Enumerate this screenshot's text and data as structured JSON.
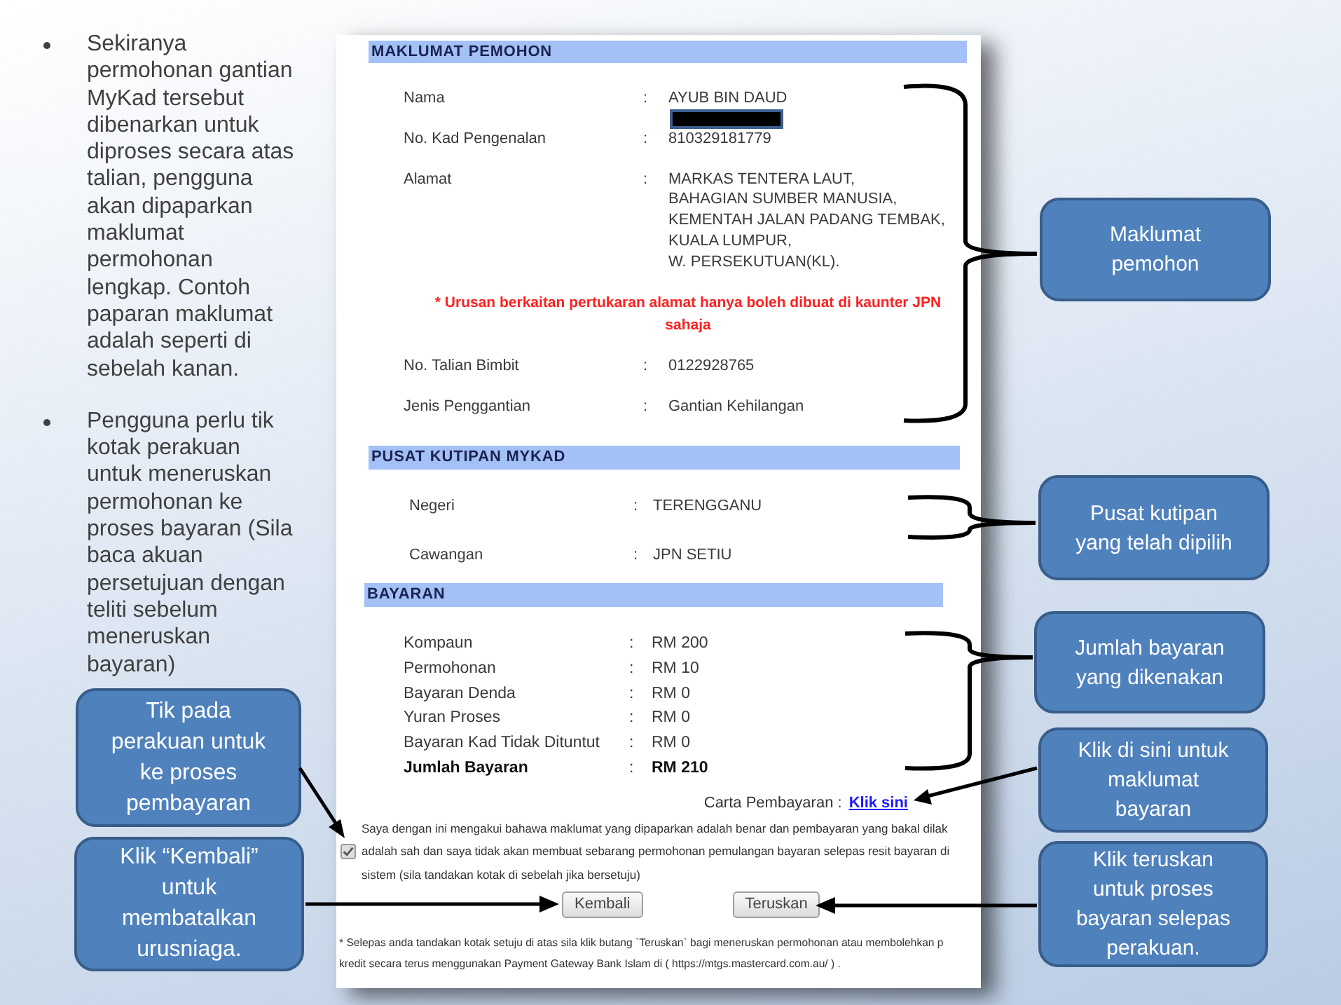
{
  "notes": [
    {
      "lines": [
        "Sekiranya",
        "permohonan gantian",
        "MyKad tersebut",
        "dibenarkan untuk",
        "diproses secara atas",
        "talian, pengguna",
        "akan dipaparkan",
        "maklumat",
        "permohonan",
        "lengkap. Contoh",
        "paparan maklumat",
        "adalah seperti di",
        "sebelah kanan."
      ]
    },
    {
      "lines": [
        "Pengguna perlu tik",
        "kotak perakuan",
        "untuk meneruskan",
        "permohonan ke",
        "proses bayaran (Sila",
        "baca akuan",
        "persetujuan dengan",
        "teliti sebelum",
        "meneruskan",
        "bayaran)"
      ]
    }
  ],
  "form": {
    "sections": [
      {
        "kind": "applicant",
        "title": "MAKLUMAT PEMOHON",
        "items": [
          {
            "kind": "field",
            "label": "Nama",
            "separator": ":",
            "lines": [
              "AYUB BIN DAUD"
            ],
            "redacted": true
          },
          {
            "kind": "field",
            "label": "No. Kad Pengenalan",
            "separator": ":",
            "lines": [
              "810329181779"
            ]
          },
          {
            "kind": "field",
            "label": "Alamat",
            "separator": ":",
            "lines": [
              "MARKAS TENTERA LAUT,",
              "BAHAGIAN SUMBER MANUSIA,",
              "KEMENTAH JALAN PADANG TEMBAK,",
              "KUALA LUMPUR,",
              "W. PERSEKUTUAN(KL)."
            ]
          },
          {
            "kind": "notice",
            "text": "* Urusan berkaitan pertukaran alamat hanya boleh dibuat di kaunter JPN sahaja"
          },
          {
            "kind": "field",
            "label": "No. Talian Bimbit",
            "separator": ":",
            "lines": [
              "0122928765"
            ]
          },
          {
            "kind": "field",
            "label": "Jenis Penggantian",
            "separator": ":",
            "lines": [
              "Gantian Kehilangan"
            ]
          }
        ]
      },
      {
        "kind": "collection",
        "title": "PUSAT KUTIPAN MYKAD",
        "items": [
          {
            "kind": "field",
            "label": "Negeri",
            "separator": ":",
            "lines": [
              "TERENGGANU"
            ]
          },
          {
            "kind": "field",
            "label": "Cawangan",
            "separator": ":",
            "lines": [
              "JPN SETIU"
            ]
          }
        ]
      },
      {
        "kind": "payment",
        "title": "BAYARAN",
        "items": [
          {
            "kind": "field",
            "label": "Kompaun",
            "separator": ":",
            "lines": [
              "RM 200"
            ],
            "total": false
          },
          {
            "kind": "field",
            "label": "Permohonan",
            "separator": ":",
            "lines": [
              "RM 10"
            ],
            "total": false
          },
          {
            "kind": "field",
            "label": "Bayaran Denda",
            "separator": ":",
            "lines": [
              "RM 0"
            ],
            "total": false
          },
          {
            "kind": "field",
            "label": "Yuran Proses",
            "separator": ":",
            "lines": [
              "RM 0"
            ],
            "total": false
          },
          {
            "kind": "field",
            "label": "Bayaran Kad Tidak Dituntut",
            "separator": ":",
            "lines": [
              "RM 0"
            ],
            "total": false
          },
          {
            "kind": "field",
            "label": "Jumlah Bayaran",
            "separator": ":",
            "lines": [
              "RM 210"
            ],
            "total": true
          }
        ]
      }
    ],
    "chart_link": {
      "label": "Carta Pembayaran :",
      "link": "Klik sini"
    },
    "declaration": {
      "checked": true,
      "lines": [
        "Saya dengan ini mengakui bahawa maklumat yang dipaparkan adalah benar dan pembayaran yang bakal dilak",
        "adalah sah dan saya tidak akan membuat sebarang permohonan pemulangan bayaran selepas resit bayaran di",
        "sistem (sila tandakan kotak di sebelah jika bersetuju)"
      ]
    },
    "buttons": [
      {
        "label": "Kembali"
      },
      {
        "label": "Teruskan"
      }
    ],
    "footnote": {
      "lines": [
        "* Selepas anda tandakan kotak setuju di atas sila klik butang `Teruskan` bagi meneruskan permohonan atau membolehkan p",
        "kredit secara terus menggunakan Payment Gateway Bank Islam di ( https://mtgs.mastercard.com.au/ ) ."
      ]
    }
  },
  "left_callouts": [
    {
      "lines": [
        "Tik pada",
        "perakuan untuk",
        "ke proses",
        "pembayaran"
      ]
    },
    {
      "lines": [
        "Klik “Kembali”",
        "untuk",
        "membatalkan",
        "urusniaga."
      ]
    }
  ],
  "right_callouts": [
    {
      "lines": [
        "Maklumat",
        "pemohon"
      ]
    },
    {
      "lines": [
        "Pusat kutipan",
        "yang telah dipilih"
      ]
    },
    {
      "lines": [
        "Jumlah bayaran",
        "yang dikenakan"
      ]
    },
    {
      "lines": [
        "Klik di sini untuk",
        "maklumat",
        "bayaran"
      ]
    },
    {
      "lines": [
        "Klik teruskan",
        "untuk proses",
        "bayaran selepas",
        "perakuan."
      ]
    }
  ]
}
